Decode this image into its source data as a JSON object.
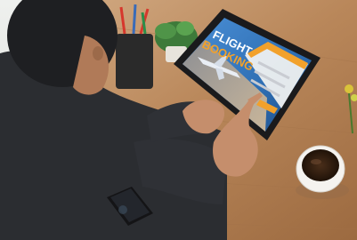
{
  "tablet_screen": {
    "title_line1": "FLIGHT",
    "title_line2": "BOOKING"
  },
  "colors": {
    "desk": "#b9875a",
    "shirt": "#2b2d31",
    "skin": "#c58e6c",
    "screen_sky": "#2f6fb4",
    "form_accent": "#f2a12b",
    "coffee": "#2b1a10"
  }
}
